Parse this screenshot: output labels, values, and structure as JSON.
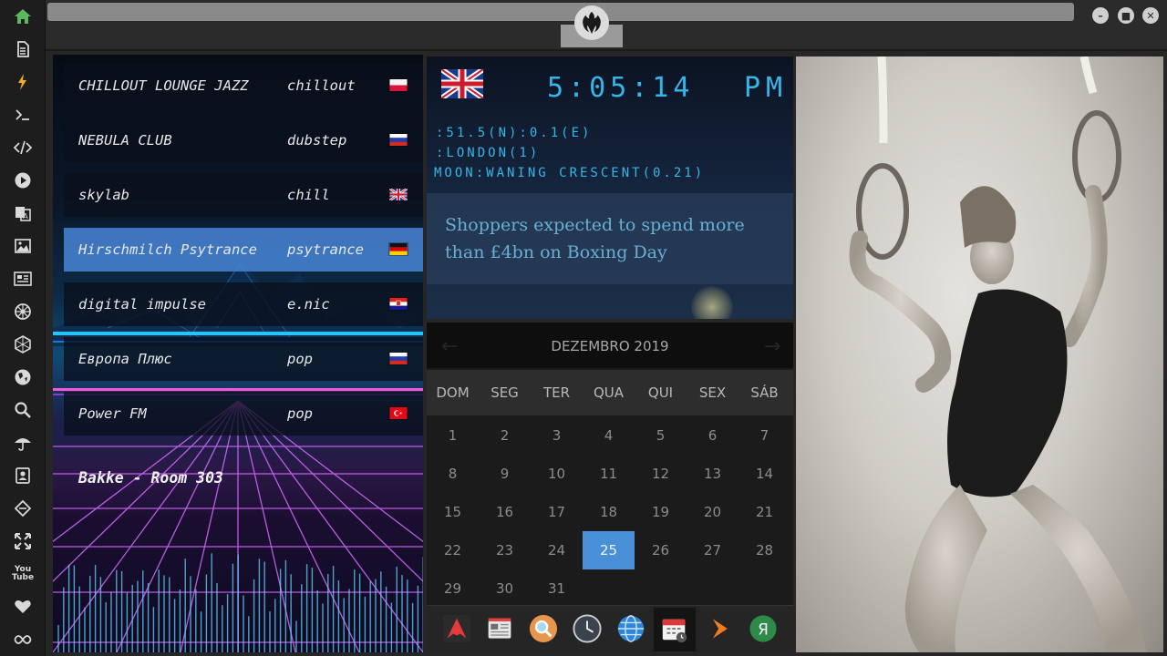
{
  "sidebar": {
    "items": [
      {
        "icon": "home-icon"
      },
      {
        "icon": "document-icon"
      },
      {
        "icon": "lightning-icon"
      },
      {
        "icon": "terminal-icon"
      },
      {
        "icon": "code-icon"
      },
      {
        "icon": "play-icon"
      },
      {
        "icon": "translate-icon"
      },
      {
        "icon": "image-icon"
      },
      {
        "icon": "newspaper-icon"
      },
      {
        "icon": "empire-icon"
      },
      {
        "icon": "hexagon-icon"
      },
      {
        "icon": "globe-icon"
      },
      {
        "icon": "search-icon"
      },
      {
        "icon": "umbrella-icon"
      },
      {
        "icon": "contact-icon"
      },
      {
        "icon": "gem-icon"
      },
      {
        "icon": "expand-icon"
      },
      {
        "icon": "youtube-icon"
      },
      {
        "icon": "heart-icon"
      },
      {
        "icon": "infinity-icon"
      }
    ],
    "youtube_label": "You\nTube",
    "active_color": "#5cb85c"
  },
  "topbar": {
    "logo_icon": "rebel-alliance-icon",
    "buttons": [
      "minimize-icon",
      "maximize-icon",
      "close-icon"
    ]
  },
  "radio": {
    "stations": [
      {
        "name": "CHILLOUT LOUNGE JAZZ",
        "genre": "chillout",
        "flag": "poland"
      },
      {
        "name": "NEBULA CLUB",
        "genre": "dubstep",
        "flag": "russia"
      },
      {
        "name": "skylab",
        "genre": "chill",
        "flag": "uk"
      },
      {
        "name": "Hirschmilch Psytrance",
        "genre": "psytrance",
        "flag": "germany"
      },
      {
        "name": "digital impulse",
        "genre": "e.nic",
        "flag": "croatia"
      },
      {
        "name": "Европа Плюс",
        "genre": "pop",
        "flag": "russia"
      },
      {
        "name": "Power FM",
        "genre": "pop",
        "flag": "turkey"
      }
    ],
    "selected_index": 3,
    "now_playing": "Bakke - Room 303"
  },
  "clock": {
    "flag": "uk",
    "time": "5:05:14",
    "ampm": "PM",
    "coordinates": ":51.5(N):0.1(E)",
    "location": ":LONDON(1)",
    "moon": "MOON:WANING CRESCENT(0.21)",
    "headline": "Shoppers expected to spend more than £4bn on Boxing Day",
    "lcd_color": "#36b5e8"
  },
  "calendar": {
    "month_label": "DEZEMBRO 2019",
    "prev_icon": "chevron-left-icon",
    "next_icon": "chevron-right-icon",
    "day_names": [
      "DOM",
      "SEG",
      "TER",
      "QUA",
      "QUI",
      "SEX",
      "SÁB"
    ],
    "weeks": [
      [
        "1",
        "2",
        "3",
        "4",
        "5",
        "6",
        "7"
      ],
      [
        "8",
        "9",
        "10",
        "11",
        "12",
        "13",
        "14"
      ],
      [
        "15",
        "16",
        "17",
        "18",
        "19",
        "20",
        "21"
      ],
      [
        "22",
        "23",
        "24",
        "25",
        "26",
        "27",
        "28"
      ],
      [
        "29",
        "30",
        "31",
        "",
        "",
        "",
        ""
      ]
    ],
    "today": "25",
    "accent": "#4a90d9"
  },
  "dock": {
    "apps": [
      "arch-linux-icon",
      "news-app-icon",
      "search-app-icon",
      "clock-app-icon",
      "web-browser-icon",
      "calendar-app-icon",
      "media-player-icon",
      "yandex-icon"
    ],
    "active_index": 5,
    "yandex_label": "Я"
  },
  "photo": {
    "description_icon": "gymnast-rings-photo"
  }
}
